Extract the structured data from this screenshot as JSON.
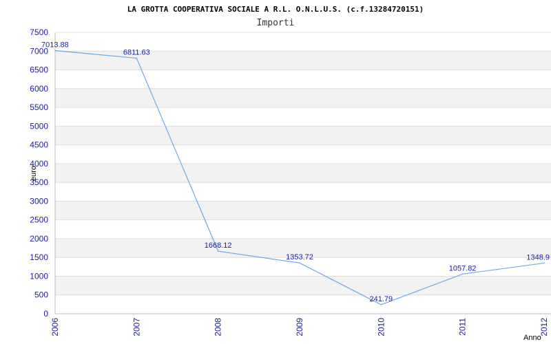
{
  "title": "LA GROTTA COOPERATIVA SOCIALE A R.L. O.N.L.U.S. (c.f.13284720151)",
  "subtitle": "Importi",
  "chart_data": {
    "type": "line",
    "x": [
      "2006",
      "2007",
      "2008",
      "2009",
      "2010",
      "2011",
      "2012"
    ],
    "series": [
      {
        "values": [
          7013.88,
          6811.63,
          1668.12,
          1353.72,
          241.79,
          1057.82,
          1348.9
        ],
        "labels": [
          "7013.88",
          "6811.63",
          "1668.12",
          "1353.72",
          "241.79",
          "1057.82",
          "1348.9"
        ]
      }
    ],
    "xlabel": "Anno",
    "ylabel": "euro",
    "ylim": [
      0,
      7500
    ],
    "yticks": [
      0,
      500,
      1000,
      1500,
      2000,
      2500,
      3000,
      3500,
      4000,
      4500,
      5000,
      5500,
      6000,
      6500,
      7000,
      7500
    ],
    "grid": "horizontal alternating bands",
    "line_color": "#6aa8e8",
    "band_color": "#f2f2f2",
    "tick_color": "#1a1aa6"
  }
}
